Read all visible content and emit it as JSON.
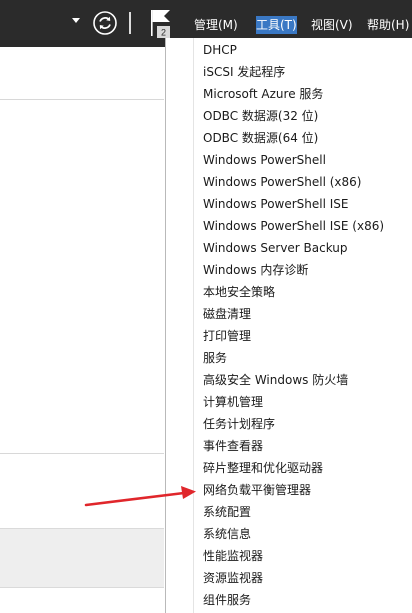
{
  "menubar": {
    "manage": "管理(M)",
    "tools": "工具(T)",
    "view": "视图(V)",
    "help": "帮助(H)"
  },
  "flag": {
    "badge": "2"
  },
  "tools_menu": [
    "DHCP",
    "iSCSI 发起程序",
    "Microsoft Azure 服务",
    "ODBC 数据源(32 位)",
    "ODBC 数据源(64 位)",
    "Windows PowerShell",
    "Windows PowerShell (x86)",
    "Windows PowerShell ISE",
    "Windows PowerShell ISE (x86)",
    "Windows Server Backup",
    "Windows 内存诊断",
    "本地安全策略",
    "磁盘清理",
    "打印管理",
    "服务",
    "高级安全 Windows 防火墙",
    "计算机管理",
    "任务计划程序",
    "事件查看器",
    "碎片整理和优化驱动器",
    "网络负载平衡管理器",
    "系统配置",
    "系统信息",
    "性能监视器",
    "资源监视器",
    "组件服务"
  ],
  "colors": {
    "topbar": "#2b2b2b",
    "menu_highlight": "#3a78c4",
    "annotation_arrow": "#e0262b"
  }
}
